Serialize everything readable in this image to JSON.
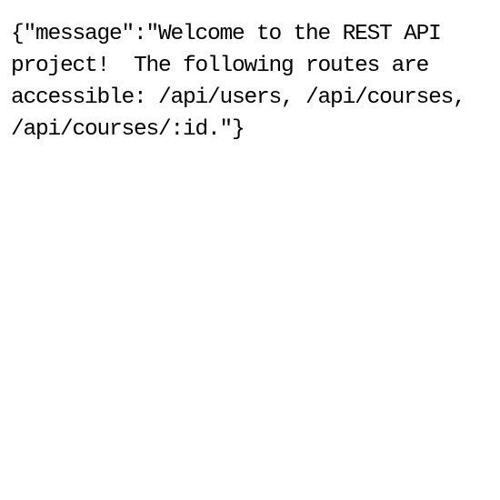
{
  "response": {
    "raw_text": "{\"message\":\"Welcome to the REST API project!  The following routes are accessible: /api/users, /api/courses, /api/courses/:id.\"}"
  }
}
